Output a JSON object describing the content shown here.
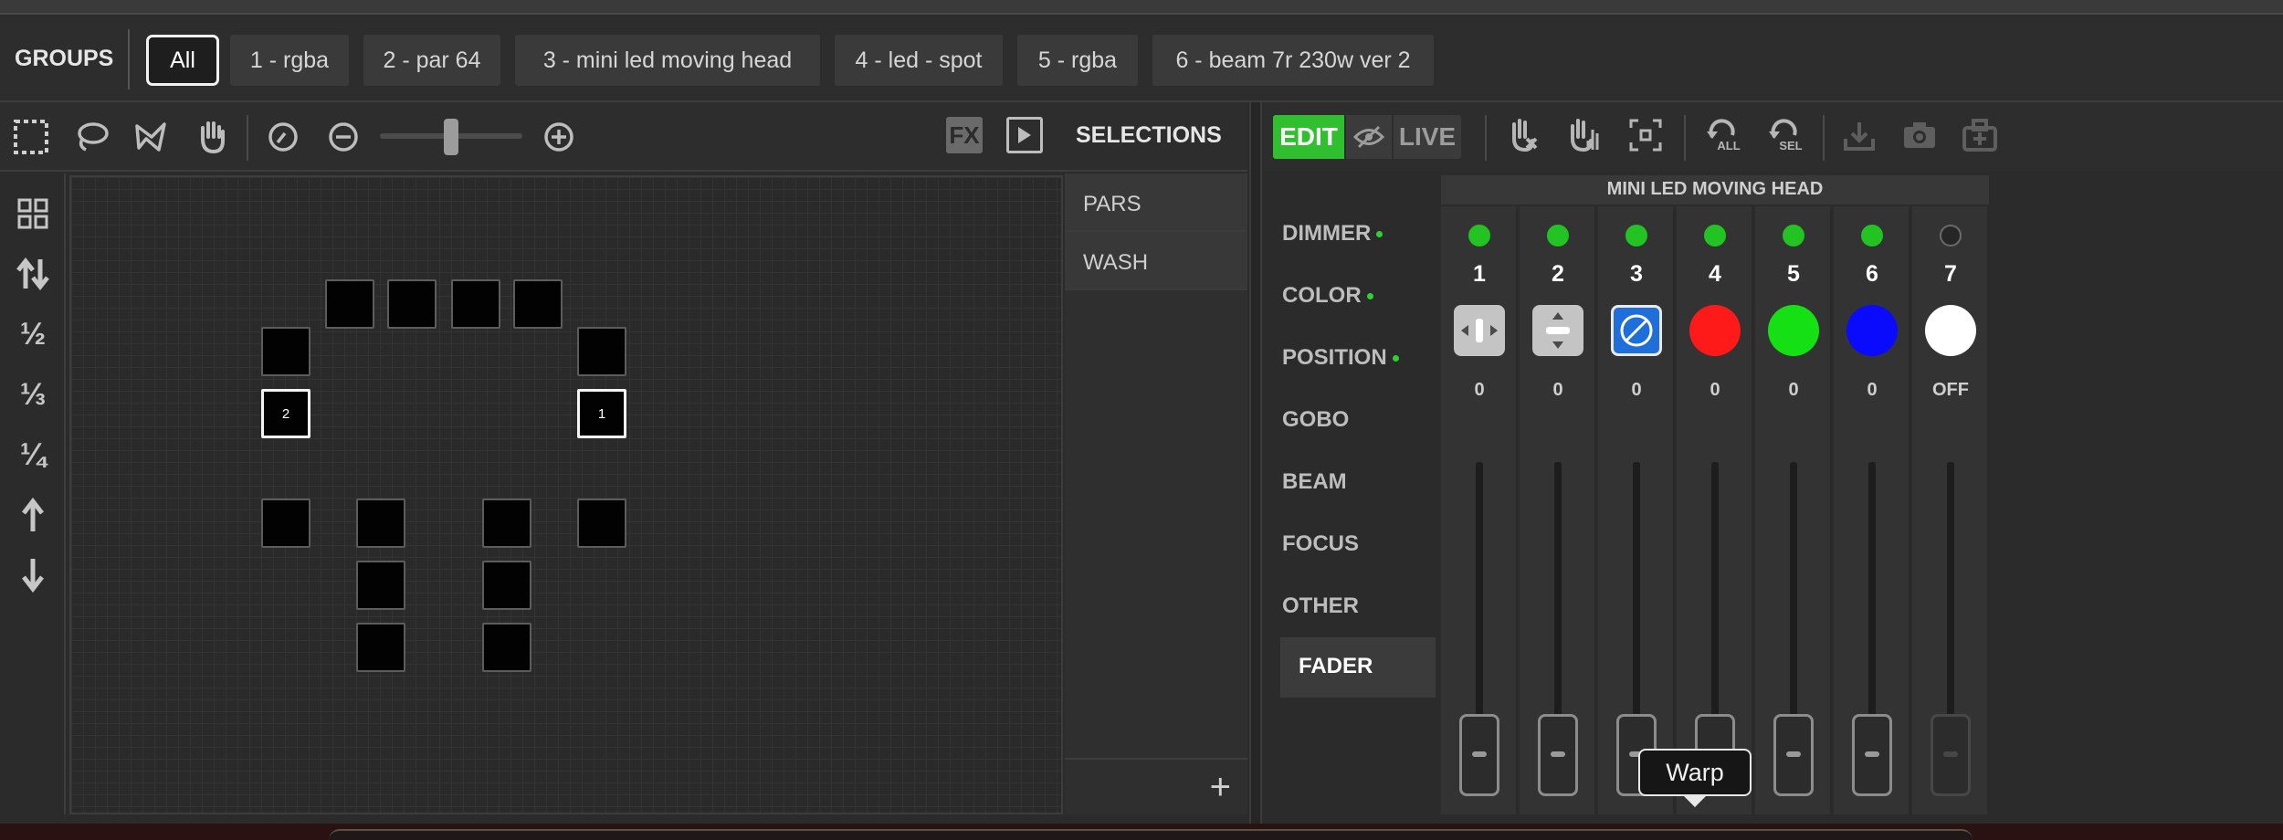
{
  "groups": {
    "label": "GROUPS",
    "items": [
      "All",
      "1 - rgba",
      "2 - par 64",
      "3 - mini led moving head",
      "4 - led - spot",
      "5 - rgba",
      "6 - beam 7r 230w ver 2"
    ],
    "active": "All"
  },
  "map_toolbar": {
    "tools": [
      "rectangle-select-icon",
      "lasso-select-icon",
      "path-select-icon",
      "hand-pan-icon",
      "rotate-icon",
      "zoom-out-icon",
      "zoom-in-icon"
    ],
    "zoom_level_fraction": 0.5,
    "fx_label": "FX"
  },
  "left_tools": {
    "labels": [
      "",
      "",
      "½",
      "⅓",
      "¼",
      "",
      ""
    ],
    "icons": [
      "grid-icon",
      "swap-vertical-icon",
      "half-icon",
      "third-icon",
      "quarter-icon",
      "arrow-up-icon",
      "arrow-down-icon"
    ]
  },
  "fixtures": {
    "selected_labels": [
      "2",
      "1"
    ]
  },
  "selections": {
    "title": "SELECTIONS",
    "items": [
      "PARS",
      "WASH"
    ],
    "add_label": "+"
  },
  "right_toolbar": {
    "edit_label": "EDIT",
    "live_label": "LIVE",
    "icons": [
      "no-touch-icon",
      "hand-fade-icon",
      "focus-target-icon",
      "undo-all-icon",
      "undo-selection-icon",
      "save-icon",
      "camera-icon",
      "store-icon"
    ],
    "undo_all_label": "ALL",
    "undo_sel_label": "SEL"
  },
  "categories": {
    "items": [
      {
        "label": "DIMMER",
        "active_dot": true
      },
      {
        "label": "COLOR",
        "active_dot": true
      },
      {
        "label": "POSITION",
        "active_dot": true
      },
      {
        "label": "GOBO",
        "active_dot": false
      },
      {
        "label": "BEAM",
        "active_dot": false
      },
      {
        "label": "FOCUS",
        "active_dot": false
      },
      {
        "label": "OTHER",
        "active_dot": false
      },
      {
        "label": "FADER",
        "active_dot": false
      }
    ],
    "active": "FADER"
  },
  "fader": {
    "title": "MINI LED MOVING HEAD",
    "channels": [
      {
        "num": "1",
        "value": "0",
        "led": "on",
        "kind": "pan",
        "color": "#c4c4c4"
      },
      {
        "num": "2",
        "value": "0",
        "led": "on",
        "kind": "tilt",
        "color": "#c4c4c4"
      },
      {
        "num": "3",
        "value": "0",
        "led": "on",
        "kind": "dimmer",
        "color": "#1e6fd9"
      },
      {
        "num": "4",
        "value": "0",
        "led": "on",
        "kind": "swatch",
        "color": "#ff1a1a"
      },
      {
        "num": "5",
        "value": "0",
        "led": "on",
        "kind": "swatch",
        "color": "#14e014"
      },
      {
        "num": "6",
        "value": "0",
        "led": "on",
        "kind": "swatch",
        "color": "#0a0aff"
      },
      {
        "num": "7",
        "value": "OFF",
        "led": "off",
        "kind": "swatch",
        "color": "#ffffff"
      }
    ]
  },
  "tooltip": {
    "text": "Warp"
  }
}
